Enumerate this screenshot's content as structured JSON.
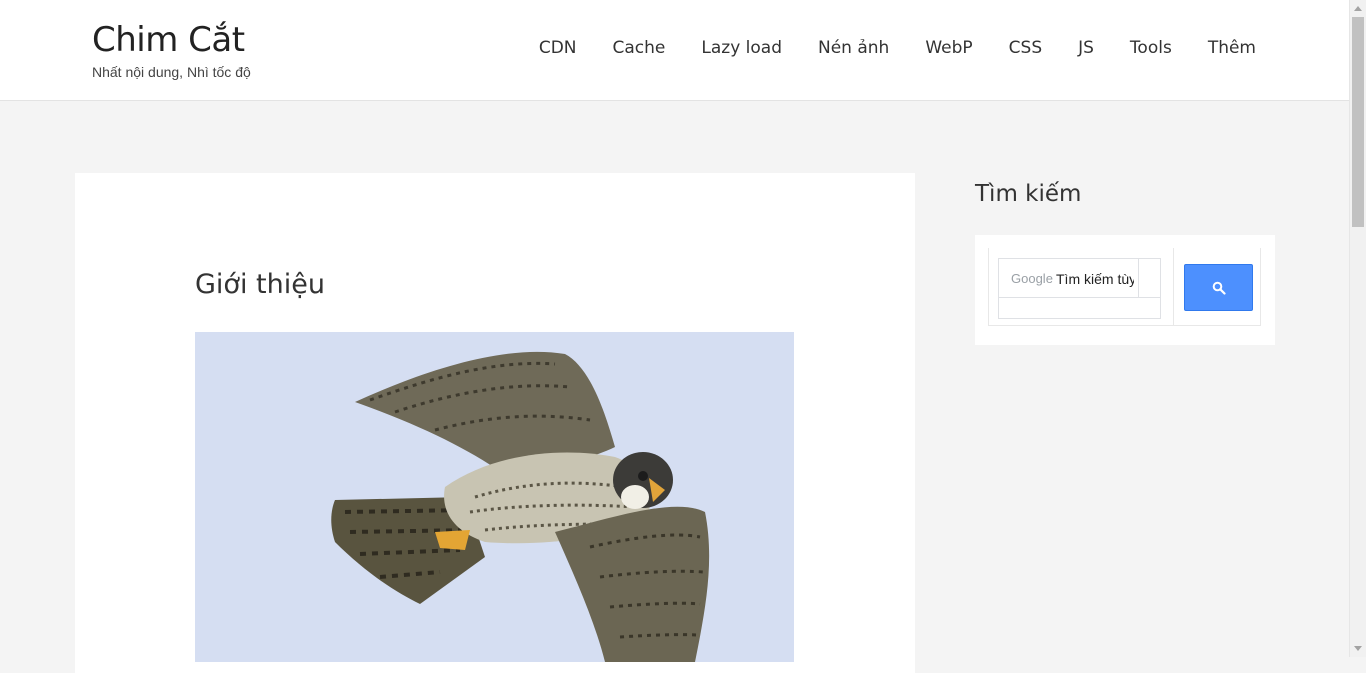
{
  "site": {
    "title": "Chim Cắt",
    "tagline": "Nhất nội dung, Nhì tốc độ"
  },
  "nav": {
    "items": [
      {
        "label": "CDN"
      },
      {
        "label": "Cache"
      },
      {
        "label": "Lazy load"
      },
      {
        "label": "Nén ảnh"
      },
      {
        "label": "WebP"
      },
      {
        "label": "CSS"
      },
      {
        "label": "JS"
      },
      {
        "label": "Tools"
      },
      {
        "label": "Thêm"
      }
    ]
  },
  "post": {
    "title": "Giới thiệu",
    "image_subject": "peregrine falcon in flight"
  },
  "sidebar": {
    "search_widget": {
      "title": "Tìm kiếm",
      "brand": "Google",
      "placeholder": "Tìm kiếm tùy chỉnh",
      "button_icon": "search-icon",
      "button_color": "#4d90fe"
    }
  }
}
